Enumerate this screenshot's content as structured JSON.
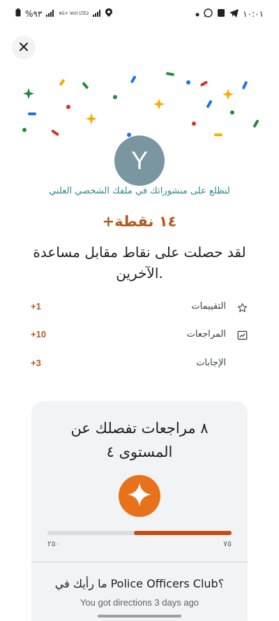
{
  "status_bar": {
    "time": "١٠:٠١",
    "battery": "%٩٣",
    "network_label": "4G+ Vo)) LTE2"
  },
  "profile": {
    "avatar_letter": "Y",
    "view_link": "لنظلع على منشوراتك في ملفك الشخصي العلني"
  },
  "points": {
    "title": "+١٤ نقطة",
    "subtitle": "لقد حصلت على نقاط مقابل مساعدة الآخرين.",
    "items": [
      {
        "label": "التقييمات",
        "value": "+1",
        "icon": "star-outline-icon"
      },
      {
        "label": "المراجعات",
        "value": "+10",
        "icon": "review-icon"
      },
      {
        "label": "الإجابات",
        "value": "+3",
        "icon": ""
      }
    ]
  },
  "level": {
    "title": "٨ مراجعات تفصلك عن المستوى ٤",
    "progress_min": "٢٥٠",
    "progress_max": "٧٥",
    "progress_fraction": 0.53,
    "badge_icon": "sparkle-star-icon"
  },
  "question": {
    "title": "ما رأيك في Police Officers Club؟",
    "subtitle": "You got directions 3 days ago"
  },
  "colors": {
    "accent": "#b35a1f",
    "badge": "#e8711c",
    "progress": "#c94a12",
    "link": "#2a8a8a",
    "avatar": "#7a96a1"
  }
}
